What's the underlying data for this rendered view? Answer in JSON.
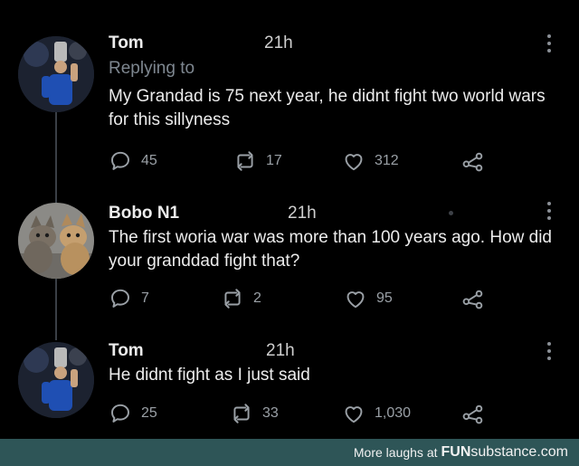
{
  "tweets": [
    {
      "name": "Tom",
      "time": "21h",
      "replying": "Replying to",
      "text": "My Grandad is 75 next year,  he didnt fight two world wars for this sillyness",
      "replies": "45",
      "retweets": "17",
      "likes": "312"
    },
    {
      "name": "Bobo N1",
      "time": "21h",
      "text": "The first woria war was more than 100 years ago. How did your granddad fight that?",
      "replies": "7",
      "retweets": "2",
      "likes": "95"
    },
    {
      "name": "Tom",
      "time": "21h",
      "text": "He didnt fight as I just said",
      "replies": "25",
      "retweets": "33",
      "likes": "1,030"
    }
  ],
  "footer": {
    "prefix": "More laughs at",
    "brand_a": "FUN",
    "brand_b": "substance.com"
  },
  "colors": {
    "background": "#000000",
    "text": "#ececec",
    "muted": "#7e8790",
    "footer_bg": "#2e5557"
  },
  "icons": [
    "reply-icon",
    "retweet-icon",
    "like-icon",
    "share-icon",
    "more-options-icon"
  ]
}
